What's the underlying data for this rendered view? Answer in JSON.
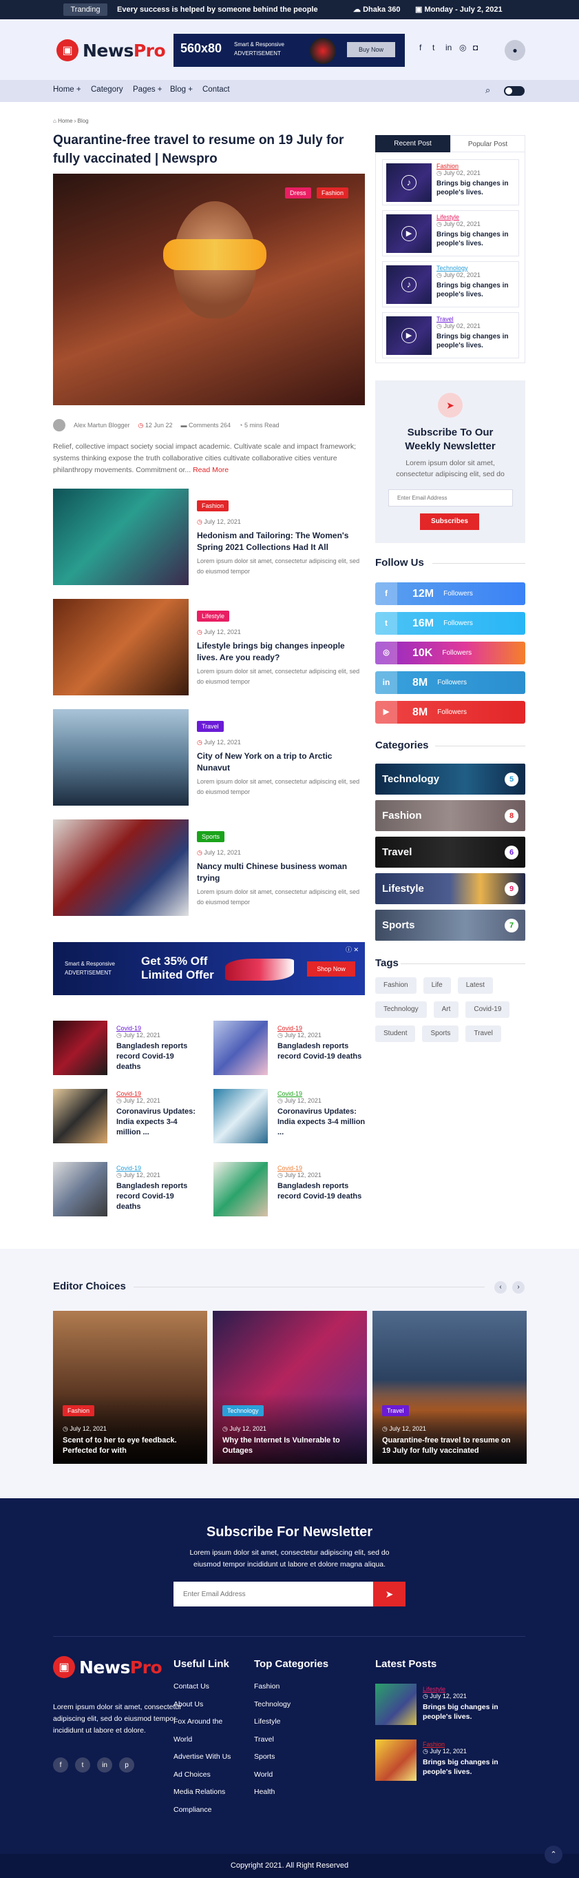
{
  "topbar": {
    "trending": "Tranding",
    "headline": "Every success is helped by someone behind the people",
    "weather": "Dhaka 360",
    "date": "Monday - July 2, 2021"
  },
  "brand": {
    "name_a": "News",
    "name_b": "Pro"
  },
  "ad_top": {
    "size": "560x80",
    "line1": "Smart & Responsive",
    "line2": "ADVERTISEMENT",
    "cta": "Buy Now"
  },
  "nav": {
    "home": "Home +",
    "category": "Category",
    "pages": "Pages +",
    "blog": "Blog +",
    "contact": "Contact"
  },
  "breadcrumb": {
    "home": "Home",
    "current": "Blog"
  },
  "article": {
    "title": "Quarantine-free travel to resume on 19 July for fully vaccinated | Newspro",
    "tags": [
      "Dress",
      "Fashion"
    ],
    "author": "Alex Martun Blogger",
    "date": "12 Jun 22",
    "comments": "Comments 264",
    "read": "5 mins Read",
    "excerpt": "Relief, collective impact society social impact academic. Cultivate scale and impact framework; systems thinking expose the truth collaborative cities cultivate collaborative cities venture philanthropy movements. Commitment or...",
    "read_more": "Read More"
  },
  "posts": [
    {
      "cat": "Fashion",
      "date": "July 12, 2021",
      "title": "Hedonism and Tailoring: The Women's Spring 2021 Collections Had It All",
      "desc": "Lorem ipsum dolor sit amet, consectetur adipiscing elit, sed do eiusmod tempor"
    },
    {
      "cat": "Lifestyle",
      "date": "July 12, 2021",
      "title": "Lifestyle brings big changes inpeople lives. Are you ready?",
      "desc": "Lorem ipsum dolor sit amet, consectetur adipiscing elit, sed do eiusmod tempor"
    },
    {
      "cat": "Travel",
      "date": "July 12, 2021",
      "title": "City of New York on a trip to Arctic Nunavut",
      "desc": "Lorem ipsum dolor sit amet, consectetur adipiscing elit, sed do eiusmod tempor"
    },
    {
      "cat": "Sports",
      "date": "July 12, 2021",
      "title": "Nancy multi Chinese business woman trying",
      "desc": "Lorem ipsum dolor sit amet, consectetur adipiscing elit, sed do eiusmod tempor"
    }
  ],
  "ad_mid": {
    "line1": "Smart & Responsive",
    "line2": "ADVERTISEMENT",
    "offer1": "Get 35% Off",
    "offer2": "Limited Offer",
    "cta": "Shop Now"
  },
  "grid": [
    {
      "cat": "Covid-19",
      "date": "July 12, 2021",
      "title": "Bangladesh reports record Covid-19 deaths"
    },
    {
      "cat": "Covid-19",
      "date": "July 12, 2021",
      "title": "Bangladesh reports record Covid-19 deaths"
    },
    {
      "cat": "Covid-19",
      "date": "July 12, 2021",
      "title": "Coronavirus Updates: India expects 3-4 million ..."
    },
    {
      "cat": "Covid-19",
      "date": "July 12, 2021",
      "title": "Coronavirus Updates: India expects 3-4 million ..."
    },
    {
      "cat": "Covid-19",
      "date": "July 12, 2021",
      "title": "Bangladesh reports record Covid-19 deaths"
    },
    {
      "cat": "Covid-19",
      "date": "July 12, 2021",
      "title": "Bangladesh reports record Covid-19 deaths"
    }
  ],
  "sidebar": {
    "tab_recent": "Recent Post",
    "tab_popular": "Popular Post",
    "recent": [
      {
        "cat": "Fashion",
        "date": "July 02, 2021",
        "title": "Brings big changes in people's lives."
      },
      {
        "cat": "Lifestyle",
        "date": "July 02, 2021",
        "title": "Brings big changes in people's lives."
      },
      {
        "cat": "Technology",
        "date": "July 02, 2021",
        "title": "Brings big changes in people's lives."
      },
      {
        "cat": "Travel",
        "date": "July 02, 2021",
        "title": "Brings big changes in people's lives."
      }
    ],
    "newsletter": {
      "title": "Subscribe To Our Weekly Newsletter",
      "text": "Lorem ipsum dolor sit amet, consectetur adipiscing elit, sed do",
      "placeholder": "Enter Email Address",
      "button": "Subscribes"
    },
    "follow_title": "Follow Us",
    "social": [
      {
        "icon": "f",
        "count": "12M",
        "label": "Followers"
      },
      {
        "icon": "t",
        "count": "16M",
        "label": "Followers"
      },
      {
        "icon": "ig",
        "count": "10K",
        "label": "Followers"
      },
      {
        "icon": "in",
        "count": "8M",
        "label": "Followers"
      },
      {
        "icon": "yt",
        "count": "8M",
        "label": "Followers"
      }
    ],
    "categories_title": "Categories",
    "categories": [
      {
        "name": "Technology",
        "count": "5"
      },
      {
        "name": "Fashion",
        "count": "8"
      },
      {
        "name": "Travel",
        "count": "6"
      },
      {
        "name": "Lifestyle",
        "count": "9"
      },
      {
        "name": "Sports",
        "count": "7"
      }
    ],
    "tags_title": "Tags",
    "tags": [
      "Fashion",
      "Life",
      "Latest",
      "Technology",
      "Art",
      "Covid-19",
      "Student",
      "Sports",
      "Travel"
    ]
  },
  "editor": {
    "title": "Editor Choices",
    "cards": [
      {
        "cat": "Fashion",
        "date": "July 12, 2021",
        "title": "Scent of to her to eye feedback. Perfected for with"
      },
      {
        "cat": "Technology",
        "date": "July 12, 2021",
        "title": "Why the Internet Is Vulnerable to Outages"
      },
      {
        "cat": "Travel",
        "date": "July 12, 2021",
        "title": "Quarantine-free travel to resume on 19 July for fully vaccinated"
      }
    ]
  },
  "newsletter": {
    "title": "Subscribe For Newsletter",
    "text1": "Lorem ipsum dolor sit amet, consectetur adipiscing elit, sed do",
    "text2": "eiusmod tempor incididunt ut labore et dolore magna aliqua.",
    "placeholder": "Enter Email Address"
  },
  "footer": {
    "about": "Lorem ipsum dolor sit amet, consectetur adipiscing elit, sed do eiusmod tempor incididunt ut labore et dolore.",
    "useful_title": "Useful Link",
    "useful": [
      "Contact Us",
      "About Us",
      "Fox Around the",
      "World",
      "Advertise With Us",
      "Ad Choices",
      "Media Relations",
      "Compliance"
    ],
    "cats_title": "Top Categories",
    "cats": [
      "Fashion",
      "Technology",
      "Lifestyle",
      "Travel",
      "Sports",
      "World",
      "Health"
    ],
    "latest_title": "Latest Posts",
    "latest": [
      {
        "cat": "Lifestyle",
        "date": "July 12, 2021",
        "title": "Brings big changes in people's lives."
      },
      {
        "cat": "Fashion",
        "date": "July 12, 2021",
        "title": "Brings big changes in people's lives."
      }
    ],
    "copyright": "Copyright 2021. All Right Reserved"
  }
}
